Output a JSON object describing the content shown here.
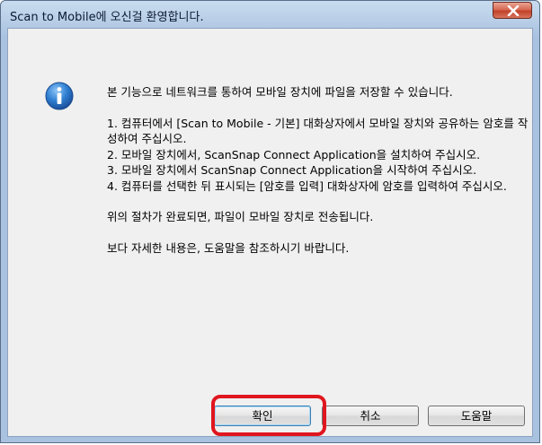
{
  "window": {
    "title": "Scan to Mobile에 오신걸 환영합니다."
  },
  "message": {
    "intro": "본 기능으로 네트워크를 통하여 모바일 장치에 파일을 저장할 수 있습니다.",
    "steps": [
      "1. 컴퓨터에서 [Scan to Mobile - 기본] 대화상자에서 모바일 장치와 공유하는 암호를 작성하여 주십시오.",
      "2. 모바일 장치에서, ScanSnap Connect Application을 설치하여 주십시오.",
      "3. 모바일 장치에서 ScanSnap Connect Application을 시작하여 주십시오.",
      "4. 컴퓨터를 선택한 뒤 표시되는 [암호를 입력] 대화상자에 암호를 입력하여 주십시오."
    ],
    "completion": "위의 절차가 완료되면, 파일이 모바일 장치로 전송됩니다.",
    "help_note": "보다 자세한 내용은, 도움말을 참조하시기 바랍니다."
  },
  "buttons": {
    "ok": "확인",
    "cancel": "취소",
    "help": "도움말"
  },
  "icons": {
    "info": "info-icon",
    "close": "close-icon"
  },
  "colors": {
    "highlight": "#e0161e",
    "close_button": "#c2412a",
    "titlebar": "#b7cde6"
  }
}
